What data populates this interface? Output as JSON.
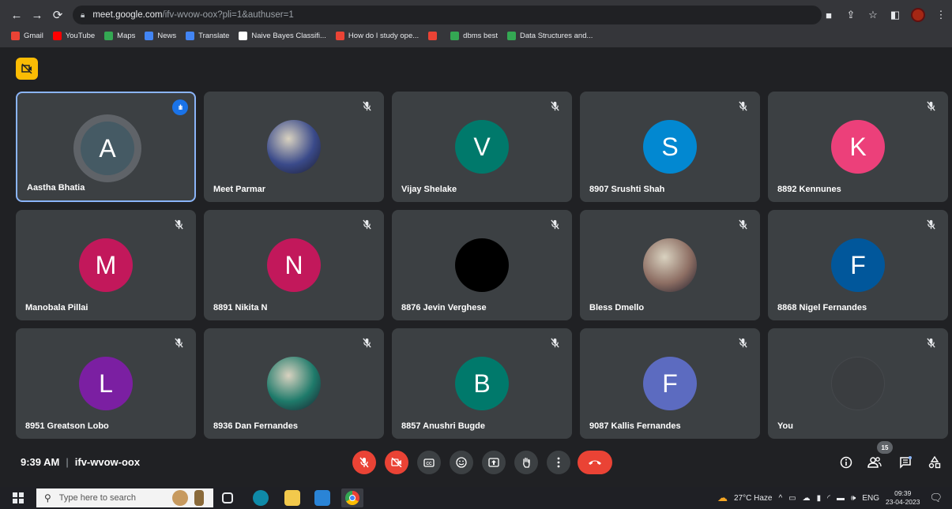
{
  "browser": {
    "url_host": "meet.google.com",
    "url_rest": "/ifv-wvow-oox?pli=1&authuser=1",
    "bookmarks": [
      {
        "label": "Gmail",
        "color": "#ea4335"
      },
      {
        "label": "YouTube",
        "color": "#ff0000"
      },
      {
        "label": "Maps",
        "color": "#34a853"
      },
      {
        "label": "News",
        "color": "#4285f4"
      },
      {
        "label": "Translate",
        "color": "#4285f4"
      },
      {
        "label": "Naive Bayes Classifi...",
        "color": "#ffffff"
      },
      {
        "label": "How do I study ope...",
        "color": "#ea4335"
      },
      {
        "label": "",
        "color": "#ea4335"
      },
      {
        "label": "dbms best",
        "color": "#34a853"
      },
      {
        "label": "Data Structures and...",
        "color": "#34a853"
      }
    ]
  },
  "participants": [
    {
      "name": "Aastha Bhatia",
      "initial": "A",
      "color": "#455a64",
      "speaking": true
    },
    {
      "name": "Meet Parmar",
      "initial": "",
      "color": "#3a4a8a",
      "photo": true
    },
    {
      "name": "Vijay Shelake",
      "initial": "V",
      "color": "#00796b"
    },
    {
      "name": "8907 Srushti Shah",
      "initial": "S",
      "color": "#0288d1"
    },
    {
      "name": "8892 Kennunes",
      "initial": "K",
      "color": "#ec407a"
    },
    {
      "name": "Manobala Pillai",
      "initial": "M",
      "color": "#c2185b"
    },
    {
      "name": "8891 Nikita N",
      "initial": "N",
      "color": "#c2185b"
    },
    {
      "name": "8876 Jevin Verghese",
      "initial": "",
      "color": "#000000"
    },
    {
      "name": "Bless Dmello",
      "initial": "",
      "color": "#8d6e63",
      "photo": true
    },
    {
      "name": "8868 Nigel Fernandes",
      "initial": "F",
      "color": "#01579b"
    },
    {
      "name": "8951 Greatson Lobo",
      "initial": "L",
      "color": "#7b1fa2"
    },
    {
      "name": "8936 Dan Fernandes",
      "initial": "",
      "color": "#1e7a6a",
      "photo": true
    },
    {
      "name": "8857 Anushri Bugde",
      "initial": "B",
      "color": "#00796b"
    },
    {
      "name": "9087 Kallis Fernandes",
      "initial": "F",
      "color": "#5c6bc0"
    },
    {
      "name": "You",
      "initial": "",
      "color": "#3c4043"
    }
  ],
  "meeting": {
    "time": "9:39 AM",
    "separator": "|",
    "code": "ifv-wvow-oox",
    "people_count": "15"
  },
  "taskbar": {
    "search_placeholder": "Type here to search",
    "weather": "27°C Haze",
    "lang": "ENG",
    "clock_time": "09:39",
    "clock_date": "23-04-2023"
  }
}
